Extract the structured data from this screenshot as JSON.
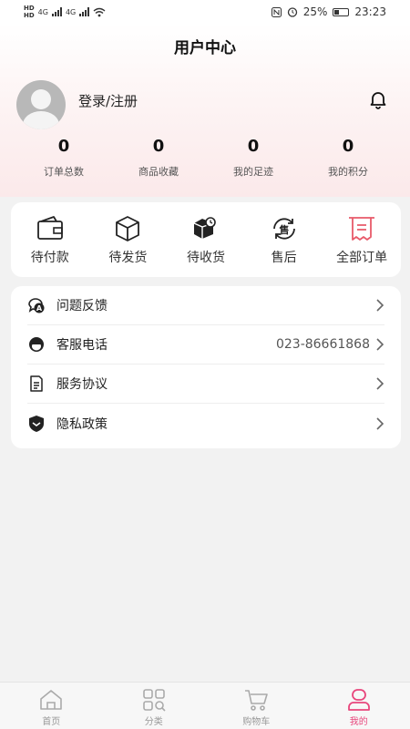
{
  "status_bar": {
    "hd_top": "HD",
    "hd_bottom": "HD",
    "network_1": "4G",
    "network_2": "4G",
    "battery": "25%",
    "time": "23:23"
  },
  "header": {
    "title": "用户中心",
    "login_label": "登录/注册"
  },
  "stats": [
    {
      "value": "0",
      "label": "订单总数"
    },
    {
      "value": "0",
      "label": "商品收藏"
    },
    {
      "value": "0",
      "label": "我的足迹"
    },
    {
      "value": "0",
      "label": "我的积分"
    }
  ],
  "orders": [
    {
      "label": "待付款",
      "icon": "wallet-icon"
    },
    {
      "label": "待发货",
      "icon": "box-icon"
    },
    {
      "label": "待收货",
      "icon": "delivery-icon"
    },
    {
      "label": "售后",
      "icon": "after-sale-icon"
    },
    {
      "label": "全部订单",
      "icon": "receipt-icon"
    }
  ],
  "menu": [
    {
      "label": "问题反馈",
      "value": "",
      "icon": "feedback-icon"
    },
    {
      "label": "客服电话",
      "value": "023-86661868",
      "icon": "customer-service-icon"
    },
    {
      "label": "服务协议",
      "value": "",
      "icon": "document-icon"
    },
    {
      "label": "隐私政策",
      "value": "",
      "icon": "shield-icon"
    }
  ],
  "tabbar": [
    {
      "label": "首页",
      "icon": "home-icon",
      "active": false
    },
    {
      "label": "分类",
      "icon": "category-icon",
      "active": false
    },
    {
      "label": "购物车",
      "icon": "cart-icon",
      "active": false
    },
    {
      "label": "我的",
      "icon": "profile-icon",
      "active": true
    }
  ],
  "colors": {
    "accent": "#e8467c",
    "header_gradient_end": "#fbe9ea",
    "receipt_icon": "#e85a6a"
  }
}
